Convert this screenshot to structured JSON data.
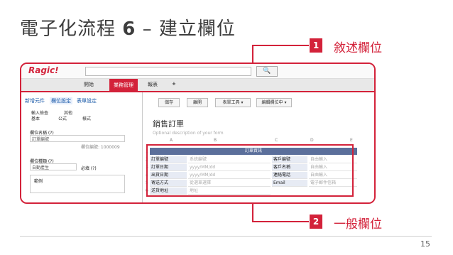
{
  "slide": {
    "title_main": "電子化流程 ",
    "title_num": "6",
    "title_rest": " – 建立欄位",
    "page_number": "15"
  },
  "callouts": [
    {
      "number": "1",
      "label": "敘述欄位"
    },
    {
      "number": "2",
      "label": "一般欄位"
    }
  ],
  "app": {
    "logo": "Ragic!",
    "search_button": "🔍",
    "nav": [
      "開始",
      "業務管理",
      "報表",
      "+"
    ],
    "left_tabs": [
      "新增元件",
      "欄位設定",
      "表單設定"
    ],
    "sub_tabs_row1": [
      "輸入檢查",
      "其他"
    ],
    "sub_tabs_row2": [
      "基本",
      "公式",
      "樣式"
    ],
    "field_name_label": "欄位名稱 (?)",
    "field_name_value": "訂單編號",
    "field_id": "欄位編號: 1000009",
    "field_type_label": "欄位種類 (?)",
    "field_type_value": "自動產生",
    "required_label": "必填 (?)",
    "example_label": "範例",
    "toolbar": [
      "儲存",
      "離開",
      "表單工具 ▾",
      "編輯欄位中 ▾"
    ],
    "form_title": "銷售訂單",
    "form_description": "Optional description of your form",
    "columns": [
      "A",
      "B",
      "C",
      "D",
      "E"
    ],
    "grid_header": "訂單資訊",
    "rows": [
      {
        "n": "1",
        "cells": []
      },
      {
        "n": "2",
        "cells": [
          "訂單編號",
          "系統編號",
          "客戶編號",
          "自由輸入"
        ]
      },
      {
        "n": "3",
        "cells": [
          "訂單日期",
          "yyyy/MM/dd",
          "客戶名稱",
          "自由輸入"
        ]
      },
      {
        "n": "4",
        "cells": [
          "出貨日期",
          "yyyy/MM/dd",
          "連絡電話",
          "自由輸入"
        ]
      },
      {
        "n": "5",
        "cells": [
          "寄送方式",
          "從選單選擇",
          "Email",
          "電子郵件信箱"
        ]
      },
      {
        "n": "6",
        "cells": [
          "送貨地址",
          "地址",
          "",
          ""
        ]
      }
    ]
  }
}
